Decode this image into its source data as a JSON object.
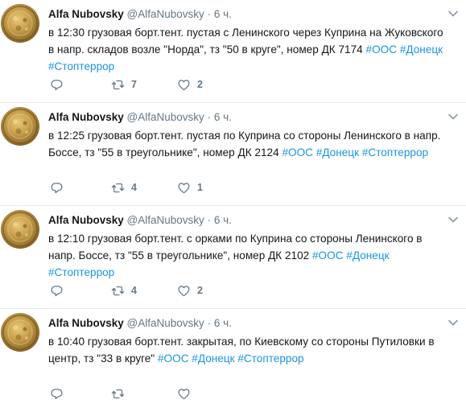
{
  "tweets": [
    {
      "name": "Alfa Nubovsky",
      "handle": "@AlfaNubovsky",
      "sep": "·",
      "time": "6 ч.",
      "text_parts": [
        {
          "t": "в 12:30 грузовая борт.тент. пустая с Ленинского через Куприна на Жуковского в напр. складов возле \"Норда\", тз \"50 в круге\", номер ДК 7174 ",
          "tag": false
        },
        {
          "t": "#ООС",
          "tag": true
        },
        {
          "t": " ",
          "tag": false
        },
        {
          "t": "#Донецк",
          "tag": true
        },
        {
          "t": " ",
          "tag": false
        },
        {
          "t": "#Стоптеррор",
          "tag": true
        }
      ],
      "retweets": "7",
      "likes": "2"
    },
    {
      "name": "Alfa Nubovsky",
      "handle": "@AlfaNubovsky",
      "sep": "·",
      "time": "6 ч.",
      "text_parts": [
        {
          "t": "в 12:25 грузовая борт.тент. пустая по Куприна со стороны Ленинского в напр. Боссе, тз \"55 в треугольнике\", номер ДК 2124 ",
          "tag": false
        },
        {
          "t": "#ООС",
          "tag": true
        },
        {
          "t": " ",
          "tag": false
        },
        {
          "t": "#Донецк",
          "tag": true
        },
        {
          "t": " ",
          "tag": false
        },
        {
          "t": "#Стоптеррор",
          "tag": true
        }
      ],
      "retweets": "4",
      "likes": "1"
    },
    {
      "name": "Alfa Nubovsky",
      "handle": "@AlfaNubovsky",
      "sep": "·",
      "time": "6 ч.",
      "text_parts": [
        {
          "t": "в 12:10 грузовая борт.тент. с орками по Куприна со стороны Ленинского в напр. Боссе, тз \"55 в треугольнике\", номер ДК 2102 ",
          "tag": false
        },
        {
          "t": "#ООС",
          "tag": true
        },
        {
          "t": " ",
          "tag": false
        },
        {
          "t": "#Донецк",
          "tag": true
        },
        {
          "t": " ",
          "tag": false
        },
        {
          "t": "#Стоптеррор",
          "tag": true
        }
      ],
      "retweets": "4",
      "likes": "2"
    },
    {
      "name": "Alfa Nubovsky",
      "handle": "@AlfaNubovsky",
      "sep": "·",
      "time": "6 ч.",
      "text_parts": [
        {
          "t": "в 10:40 грузовая борт.тент. закрытая, по Киевскому со стороны Путиловки в центр, тз \"33 в круге\" ",
          "tag": false
        },
        {
          "t": "#ООС",
          "tag": true
        },
        {
          "t": " ",
          "tag": false
        },
        {
          "t": "#Донецк",
          "tag": true
        },
        {
          "t": " ",
          "tag": false
        },
        {
          "t": "#Стоптеррор",
          "tag": true
        }
      ],
      "retweets": "",
      "likes": ""
    }
  ],
  "icons": {
    "reply": "reply-icon",
    "retweet": "retweet-icon",
    "like": "heart-icon",
    "menu": "chevron-down-icon"
  },
  "colors": {
    "hashtag": "#1b95e0",
    "secondary_text": "#657786",
    "divider": "#e6ecf0"
  }
}
